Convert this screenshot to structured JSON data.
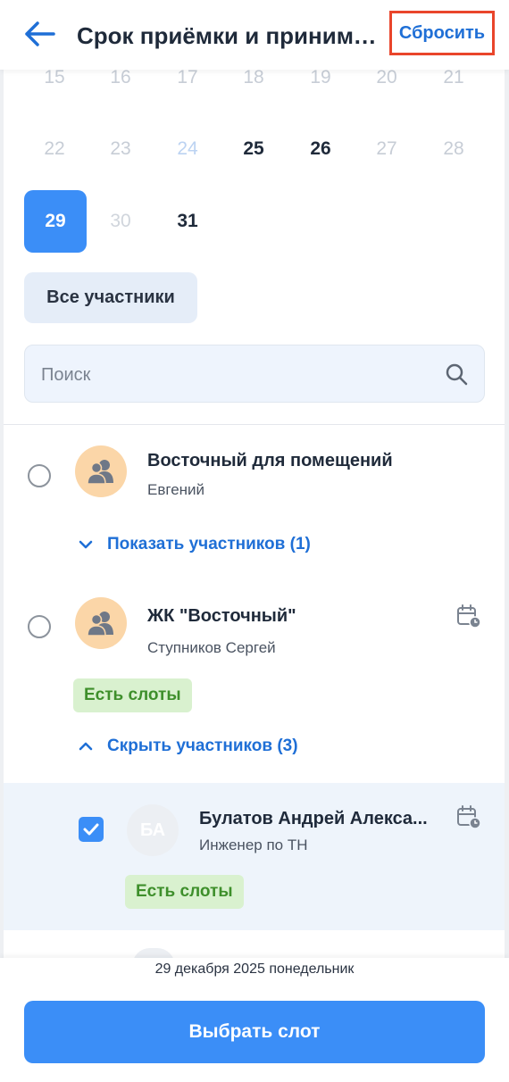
{
  "header": {
    "title": "Срок приёмки и принимающие",
    "reset_label": "Сбросить"
  },
  "calendar": {
    "row1": [
      "15",
      "16",
      "17",
      "18",
      "19",
      "20",
      "21"
    ],
    "row2": [
      "22",
      "23",
      "24",
      "25",
      "26",
      "27",
      "28"
    ],
    "row3": [
      "29",
      "30",
      "31"
    ],
    "selected_day": "29"
  },
  "filter": {
    "all_participants_label": "Все участники"
  },
  "search": {
    "placeholder": "Поиск",
    "value": ""
  },
  "groups": [
    {
      "name": "Восточный для помещений",
      "subtitle": "Евгений",
      "toggle_label": "Показать участников (1)",
      "expanded": false
    },
    {
      "name": "ЖК \"Восточный\"",
      "subtitle": "Ступников Сергей",
      "badge": "Есть слоты",
      "toggle_label": "Скрыть участников (3)",
      "expanded": true,
      "members": [
        {
          "initials": "БА",
          "name": "Булатов Андрей Алекса...",
          "role": "Инженер по ТН",
          "badge": "Есть слоты",
          "checked": true
        }
      ]
    }
  ],
  "footer": {
    "date": "29 декабря 2025 понедельник",
    "primary_label": "Выбрать слот"
  },
  "colors": {
    "accent": "#3b8ef7",
    "link": "#1f6fd6",
    "badge_bg": "#d9f1cf",
    "badge_text": "#3e8f2b",
    "highlight": "#e9452b"
  }
}
